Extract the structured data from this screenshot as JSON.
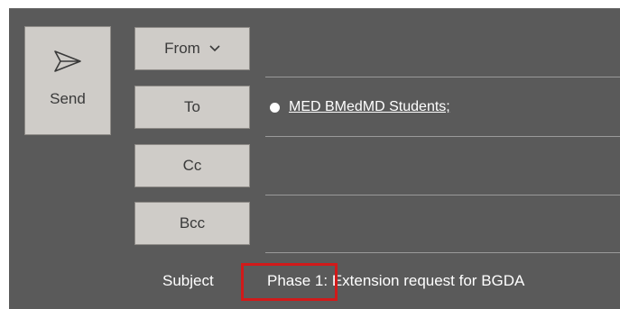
{
  "toolbar": {
    "send_label": "Send",
    "send_icon": "send-icon"
  },
  "fields": {
    "from_label": "From",
    "to_label": "To",
    "cc_label": "Cc",
    "bcc_label": "Bcc",
    "subject_label": "Subject"
  },
  "recipients": {
    "to": [
      "MED BMedMD Students;"
    ]
  },
  "subject": {
    "value": "Phase 1: Extension request for BGDA"
  },
  "colors": {
    "background": "#5a5a5a",
    "button": "#cfccc8",
    "highlight": "#d11a1a"
  }
}
